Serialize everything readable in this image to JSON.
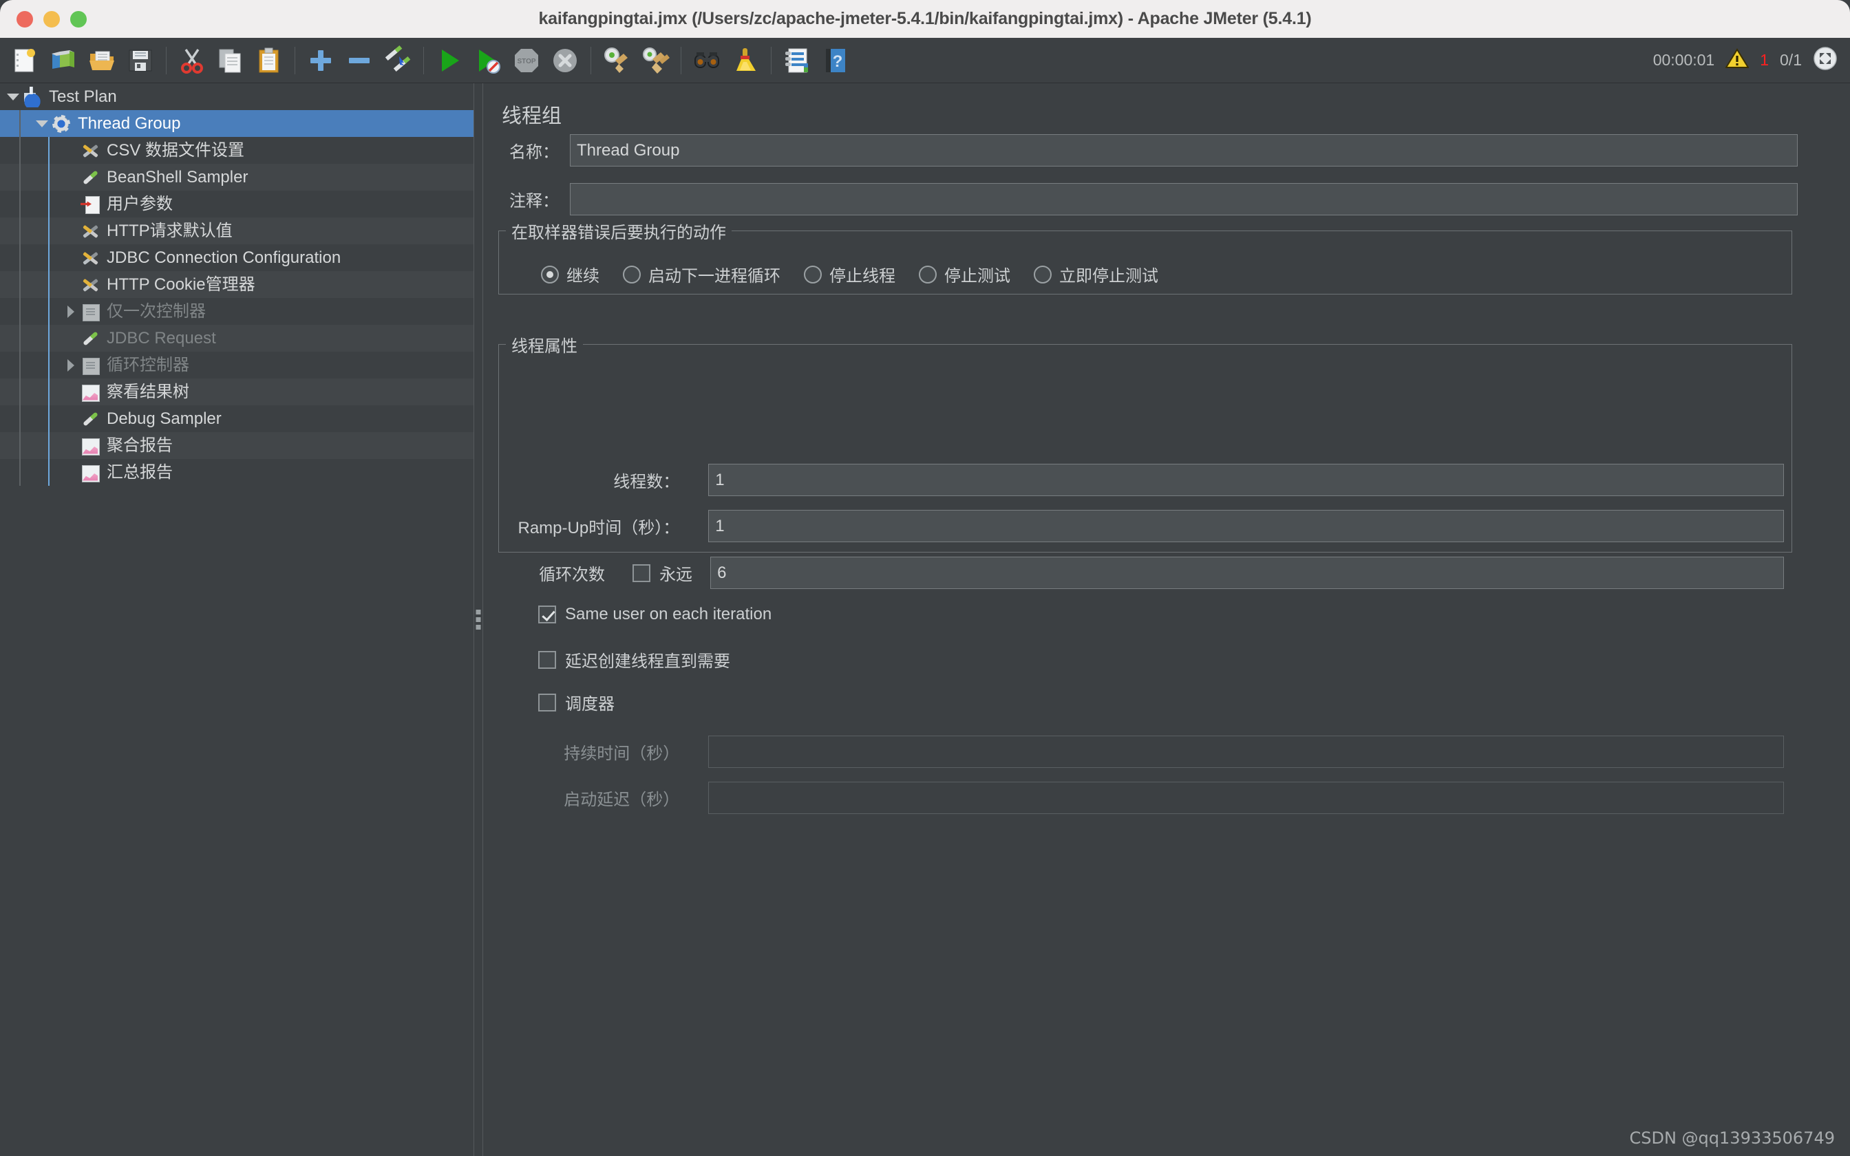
{
  "window": {
    "title": "kaifangpingtai.jmx (/Users/zc/apache-jmeter-5.4.1/bin/kaifangpingtai.jmx) - Apache JMeter (5.4.1)",
    "controls": [
      "close",
      "minimize",
      "maximize"
    ]
  },
  "toolbar": {
    "buttons": [
      {
        "name": "new-icon",
        "tip": "New"
      },
      {
        "name": "templates-icon",
        "tip": "Templates"
      },
      {
        "name": "open-icon",
        "tip": "Open"
      },
      {
        "name": "save-icon",
        "tip": "Save Test Plan"
      },
      {
        "name": "cut-icon",
        "tip": "Cut"
      },
      {
        "name": "copy-icon",
        "tip": "Copy"
      },
      {
        "name": "paste-icon",
        "tip": "Paste"
      },
      {
        "name": "expand-all-icon",
        "tip": "Expand All"
      },
      {
        "name": "collapse-all-icon",
        "tip": "Collapse All"
      },
      {
        "name": "toggle-icon",
        "tip": "Toggle"
      },
      {
        "name": "start-icon",
        "tip": "Start"
      },
      {
        "name": "start-no-pause-icon",
        "tip": "Start no pauses"
      },
      {
        "name": "stop-icon",
        "tip": "Stop"
      },
      {
        "name": "shutdown-icon",
        "tip": "Shutdown"
      },
      {
        "name": "clear-icon",
        "tip": "Clear"
      },
      {
        "name": "clear-all-icon",
        "tip": "Clear All"
      },
      {
        "name": "search-icon",
        "tip": "Search"
      },
      {
        "name": "reset-search-icon",
        "tip": "Reset Search"
      },
      {
        "name": "function-helper-icon",
        "tip": "Function Helper Dialog"
      },
      {
        "name": "help-icon",
        "tip": "Help"
      }
    ],
    "status": {
      "elapsed": "00:00:01",
      "warning_icon": "warning-triangle-icon",
      "warning_count": "1",
      "threads": "0/1",
      "remote_icon": "remote-status-icon"
    }
  },
  "tree": {
    "nodes": [
      {
        "label": "Test Plan",
        "indent": 0,
        "icon": "testplan-icon",
        "twisty": "down",
        "selected": false,
        "dim": false
      },
      {
        "label": "Thread Group",
        "indent": 1,
        "icon": "threadgroup-icon",
        "twisty": "down",
        "selected": true,
        "dim": false
      },
      {
        "label": "CSV 数据文件设置",
        "indent": 2,
        "icon": "config-icon",
        "twisty": "none",
        "selected": false,
        "dim": false
      },
      {
        "label": "BeanShell Sampler",
        "indent": 2,
        "icon": "sampler-icon",
        "twisty": "none",
        "selected": false,
        "dim": false
      },
      {
        "label": "用户参数",
        "indent": 2,
        "icon": "userparams-icon",
        "twisty": "none",
        "selected": false,
        "dim": false
      },
      {
        "label": "HTTP请求默认值",
        "indent": 2,
        "icon": "config-icon",
        "twisty": "none",
        "selected": false,
        "dim": false
      },
      {
        "label": "JDBC Connection Configuration",
        "indent": 2,
        "icon": "config-icon",
        "twisty": "none",
        "selected": false,
        "dim": false
      },
      {
        "label": "HTTP Cookie管理器",
        "indent": 2,
        "icon": "config-icon",
        "twisty": "none",
        "selected": false,
        "dim": false
      },
      {
        "label": "仅一次控制器",
        "indent": 2,
        "icon": "controller-icon",
        "twisty": "right",
        "selected": false,
        "dim": true
      },
      {
        "label": "JDBC Request",
        "indent": 2,
        "icon": "sampler-icon",
        "twisty": "none",
        "selected": false,
        "dim": true
      },
      {
        "label": "循环控制器",
        "indent": 2,
        "icon": "controller-icon",
        "twisty": "right",
        "selected": false,
        "dim": true
      },
      {
        "label": "察看结果树",
        "indent": 2,
        "icon": "listener-icon",
        "twisty": "none",
        "selected": false,
        "dim": false
      },
      {
        "label": "Debug Sampler",
        "indent": 2,
        "icon": "sampler-icon",
        "twisty": "none",
        "selected": false,
        "dim": false
      },
      {
        "label": "聚合报告",
        "indent": 2,
        "icon": "listener-icon",
        "twisty": "none",
        "selected": false,
        "dim": false
      },
      {
        "label": "汇总报告",
        "indent": 2,
        "icon": "listener-icon",
        "twisty": "none",
        "selected": false,
        "dim": false
      }
    ]
  },
  "content": {
    "panel_title": "线程组",
    "name_label": "名称：",
    "name_value": "Thread Group",
    "comment_label": "注释：",
    "comment_value": "",
    "error_action": {
      "legend": "在取样器错误后要执行的动作",
      "options": [
        {
          "label": "继续",
          "checked": true
        },
        {
          "label": "启动下一进程循环",
          "checked": false
        },
        {
          "label": "停止线程",
          "checked": false
        },
        {
          "label": "停止测试",
          "checked": false
        },
        {
          "label": "立即停止测试",
          "checked": false
        }
      ]
    },
    "thread_props": {
      "legend": "线程属性",
      "threads_label": "线程数：",
      "threads_value": "1",
      "rampup_label": "Ramp-Up时间（秒）：",
      "rampup_value": "1",
      "loops_label": "循环次数",
      "forever_label": "永远",
      "forever_checked": false,
      "loops_value": "6",
      "same_user_label": "Same user on each iteration",
      "same_user_checked": true,
      "delay_create_label": "延迟创建线程直到需要",
      "delay_create_checked": false,
      "scheduler_label": "调度器",
      "scheduler_checked": false,
      "duration_label": "持续时间（秒）",
      "duration_value": "",
      "startup_delay_label": "启动延迟（秒）",
      "startup_delay_value": ""
    }
  },
  "watermark": "CSDN @qq13933506749",
  "colors": {
    "window_bg": "#3c4043",
    "titlebar_bg": "#f0eeee",
    "selection": "#4a7ebb",
    "field_bg": "#4b5053",
    "text": "#cdd0d2",
    "text_dim": "#8a9093",
    "warning_red": "#ff2020"
  }
}
